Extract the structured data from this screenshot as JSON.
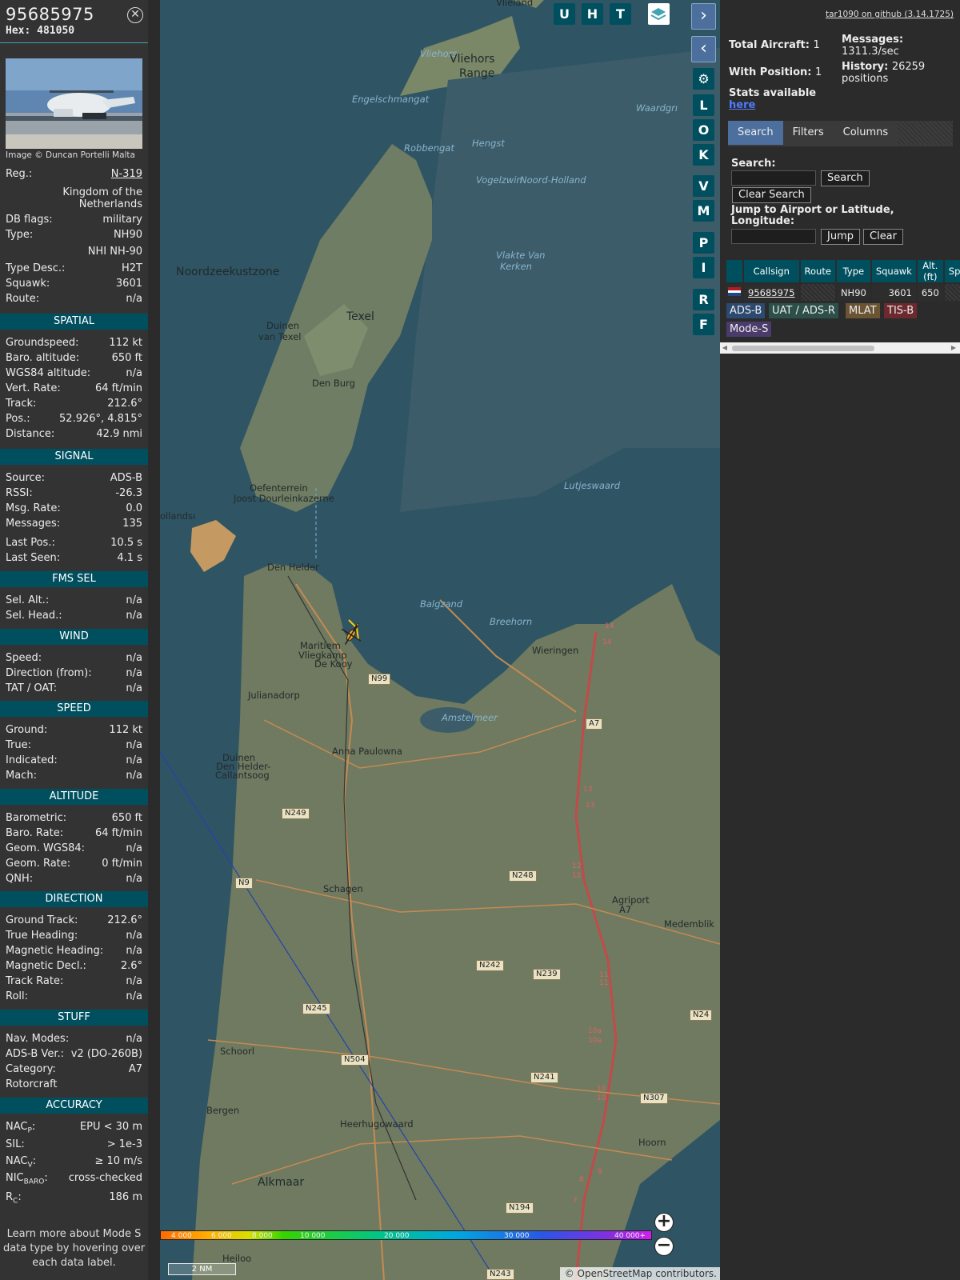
{
  "info": {
    "callsign": "95685975",
    "hex": "Hex: 481050",
    "photo_credit": "Image © Duncan Portelli Malta",
    "rows_top": [
      {
        "k": "Reg.:",
        "v": "N-319"
      },
      {
        "k": "",
        "v": "Kingdom of the Netherlands"
      },
      {
        "k": "DB flags:",
        "v": "military"
      },
      {
        "k": "Type:",
        "v": "NH90"
      },
      {
        "k": "",
        "v": "NHI NH-90"
      },
      {
        "k": "Type Desc.:",
        "v": "H2T"
      },
      {
        "k": "Squawk:",
        "v": "3601"
      },
      {
        "k": "Route:",
        "v": "n/a"
      }
    ],
    "sections": {
      "spatial": "SPATIAL",
      "signal": "SIGNAL",
      "fms": "FMS SEL",
      "wind": "WIND",
      "speed": "SPEED",
      "altitude": "ALTITUDE",
      "direction": "DIRECTION",
      "stuff": "STUFF",
      "accuracy": "ACCURACY"
    },
    "spatial": [
      {
        "k": "Groundspeed:",
        "v": "112 kt"
      },
      {
        "k": "Baro. altitude:",
        "v": "650 ft"
      },
      {
        "k": "WGS84 altitude:",
        "v": "n/a"
      },
      {
        "k": "Vert. Rate:",
        "v": "64 ft/min"
      },
      {
        "k": "Track:",
        "v": "212.6°"
      },
      {
        "k": "Pos.:",
        "v": "52.926°, 4.815°"
      },
      {
        "k": "Distance:",
        "v": "42.9 nmi"
      }
    ],
    "signal": [
      {
        "k": "Source:",
        "v": "ADS-B"
      },
      {
        "k": "RSSI:",
        "v": "-26.3"
      },
      {
        "k": "Msg. Rate:",
        "v": "0.0"
      },
      {
        "k": "Messages:",
        "v": "135"
      },
      {
        "k": "Last Pos.:",
        "v": "10.5 s"
      },
      {
        "k": "Last Seen:",
        "v": "4.1 s"
      }
    ],
    "fms": [
      {
        "k": "Sel. Alt.:",
        "v": "n/a"
      },
      {
        "k": "Sel. Head.:",
        "v": "n/a"
      }
    ],
    "wind": [
      {
        "k": "Speed:",
        "v": "n/a"
      },
      {
        "k": "Direction (from):",
        "v": "n/a"
      },
      {
        "k": "TAT / OAT:",
        "v": "n/a"
      }
    ],
    "speed": [
      {
        "k": "Ground:",
        "v": "112 kt"
      },
      {
        "k": "True:",
        "v": "n/a"
      },
      {
        "k": "Indicated:",
        "v": "n/a"
      },
      {
        "k": "Mach:",
        "v": "n/a"
      }
    ],
    "altitude": [
      {
        "k": "Barometric:",
        "v": "650 ft"
      },
      {
        "k": "Baro. Rate:",
        "v": "64 ft/min"
      },
      {
        "k": "Geom. WGS84:",
        "v": "n/a"
      },
      {
        "k": "Geom. Rate:",
        "v": "0 ft/min"
      },
      {
        "k": "QNH:",
        "v": "n/a"
      }
    ],
    "direction": [
      {
        "k": "Ground Track:",
        "v": "212.6°"
      },
      {
        "k": "True Heading:",
        "v": "n/a"
      },
      {
        "k": "Magnetic Heading:",
        "v": "n/a"
      },
      {
        "k": "Magnetic Decl.:",
        "v": "2.6°"
      },
      {
        "k": "Track Rate:",
        "v": "n/a"
      },
      {
        "k": "Roll:",
        "v": "n/a"
      }
    ],
    "stuff": [
      {
        "k": "Nav. Modes:",
        "v": "n/a"
      },
      {
        "k": "ADS-B Ver.:",
        "v": "v2 (DO-260B)"
      },
      {
        "k": "Category:",
        "v": "A7"
      },
      {
        "k": "Rotorcraft",
        "v": ""
      }
    ],
    "accuracy": [
      {
        "k": "NAC",
        "sub": "P",
        "v": "EPU < 30 m"
      },
      {
        "k": "SIL:",
        "sub": "",
        "v": "> 1e-3"
      },
      {
        "k": "NAC",
        "sub": "V",
        "v": "≥ 10 m/s"
      },
      {
        "k": "NIC",
        "sub": "BARO",
        "v": "cross-checked"
      },
      {
        "k": "R",
        "sub": "C",
        "v": "186 m"
      }
    ],
    "learn_more": "Learn more about Mode S data type by hovering over each data label."
  },
  "map": {
    "top_buttons": [
      "U",
      "H",
      "T"
    ],
    "side_buttons": [
      "L",
      "O",
      "K",
      "V",
      "M",
      "P",
      "I",
      "R",
      "F"
    ],
    "places": [
      {
        "t": "Vlieland",
        "cls": "dark"
      },
      {
        "t": "Vliehors",
        "cls": "water"
      },
      {
        "t": "Vliehors",
        "cls": "big"
      },
      {
        "t": "Range",
        "cls": "big"
      },
      {
        "t": "Engelschmangat",
        "cls": "water"
      },
      {
        "t": "Robbengat",
        "cls": "water"
      },
      {
        "t": "Hengst",
        "cls": "water"
      },
      {
        "t": "Vogelzwin",
        "cls": "water"
      },
      {
        "t": "Noord-Holland",
        "cls": "water"
      },
      {
        "t": "Waardgrı",
        "cls": "water"
      },
      {
        "t": "Noordzeekustzone",
        "cls": "big"
      },
      {
        "t": "Texel",
        "cls": "big"
      },
      {
        "t": "Duinen",
        "cls": "dark"
      },
      {
        "t": "van Texel",
        "cls": "dark"
      },
      {
        "t": "Den Burg",
        "cls": "dark"
      },
      {
        "t": "Vlakte Van",
        "cls": "water"
      },
      {
        "t": "Kerken",
        "cls": "water"
      },
      {
        "t": "Oefenterrein",
        "cls": "dark"
      },
      {
        "t": "Joost Dourleinkazerne",
        "cls": "dark"
      },
      {
        "t": "Lutjeswaard",
        "cls": "water"
      },
      {
        "t": "Den Helder",
        "cls": "dark"
      },
      {
        "t": "Balgzand",
        "cls": "water"
      },
      {
        "t": "Breehorn",
        "cls": "water"
      },
      {
        "t": "Wieringen",
        "cls": "dark"
      },
      {
        "t": "Maritiem",
        "cls": "dark"
      },
      {
        "t": "Vliegkamp",
        "cls": "dark"
      },
      {
        "t": "De Kooy",
        "cls": "dark"
      },
      {
        "t": "Julianadorp",
        "cls": "dark"
      },
      {
        "t": "Amstelmeer",
        "cls": "water"
      },
      {
        "t": "Anna Paulowna",
        "cls": "dark"
      },
      {
        "t": "Duinen",
        "cls": "dark"
      },
      {
        "t": "Den Helder-",
        "cls": "dark"
      },
      {
        "t": "Callantsoog",
        "cls": "dark"
      },
      {
        "t": "Schagen",
        "cls": "dark"
      },
      {
        "t": "Agriport",
        "cls": "dark"
      },
      {
        "t": "A7",
        "cls": "dark"
      },
      {
        "t": "Medemblik",
        "cls": "dark"
      },
      {
        "t": "Schoorl",
        "cls": "dark"
      },
      {
        "t": "Bergen",
        "cls": "dark"
      },
      {
        "t": "Heerhugowaard",
        "cls": "dark"
      },
      {
        "t": "Hoorn",
        "cls": "dark"
      },
      {
        "t": "Alkmaar",
        "cls": "big"
      },
      {
        "t": "Heiloo",
        "cls": "dark"
      },
      {
        "t": "ollandsı",
        "cls": "dark"
      }
    ],
    "roads": [
      "N99",
      "A7",
      "N249",
      "N248",
      "N9",
      "N242",
      "N239",
      "N245",
      "N504",
      "N241",
      "N307",
      "N194",
      "N24",
      "N243"
    ],
    "motorway_marks": [
      "14",
      "14",
      "13",
      "13",
      "12",
      "12",
      "11",
      "11",
      "10a",
      "10a",
      "10",
      "10",
      "9",
      "8",
      "7"
    ],
    "altitude_ticks": [
      "4 000",
      "6 000",
      "8 000",
      "10 000",
      "20 000",
      "30 000",
      "40 000+"
    ],
    "scale": "2 NM",
    "attribution": "© OpenStreetMap contributors.",
    "zoom_in": "+",
    "zoom_out": "−"
  },
  "sidebar": {
    "github": "tar1090 on github (3.14.1725)",
    "total_aircraft_label": "Total Aircraft:",
    "total_aircraft": "1",
    "messages_label": "Messages:",
    "messages": "1311.3/sec",
    "with_position_label": "With Position:",
    "with_position": "1",
    "history_label": "History:",
    "history": "26259 positions",
    "stats_label": "Stats available",
    "stats_link": "here",
    "tabs": [
      "Search",
      "Filters",
      "Columns"
    ],
    "search_label": "Search:",
    "search_button": "Search",
    "clear_search_button": "Clear Search",
    "jump_label": "Jump to Airport or Latitude, Longitude:",
    "jump_button": "Jump",
    "clear_button": "Clear",
    "table": {
      "headers": [
        "",
        "Callsign",
        "Route",
        "Type",
        "Squawk",
        "Alt. (ft)",
        "Sp"
      ],
      "rows": [
        [
          "",
          "95685975",
          "",
          "NH90",
          "3601",
          "650",
          ""
        ]
      ]
    },
    "chips": [
      {
        "t": "ADS-B",
        "color": "#2c4a6f"
      },
      {
        "t": "UAT / ADS-R",
        "color": "#2c4f4a"
      },
      {
        "t": "MLAT",
        "color": "#6b5434"
      },
      {
        "t": "TIS-B",
        "color": "#6c2a2e"
      },
      {
        "t": "Mode-S",
        "color": "#4a3b6b"
      }
    ]
  }
}
